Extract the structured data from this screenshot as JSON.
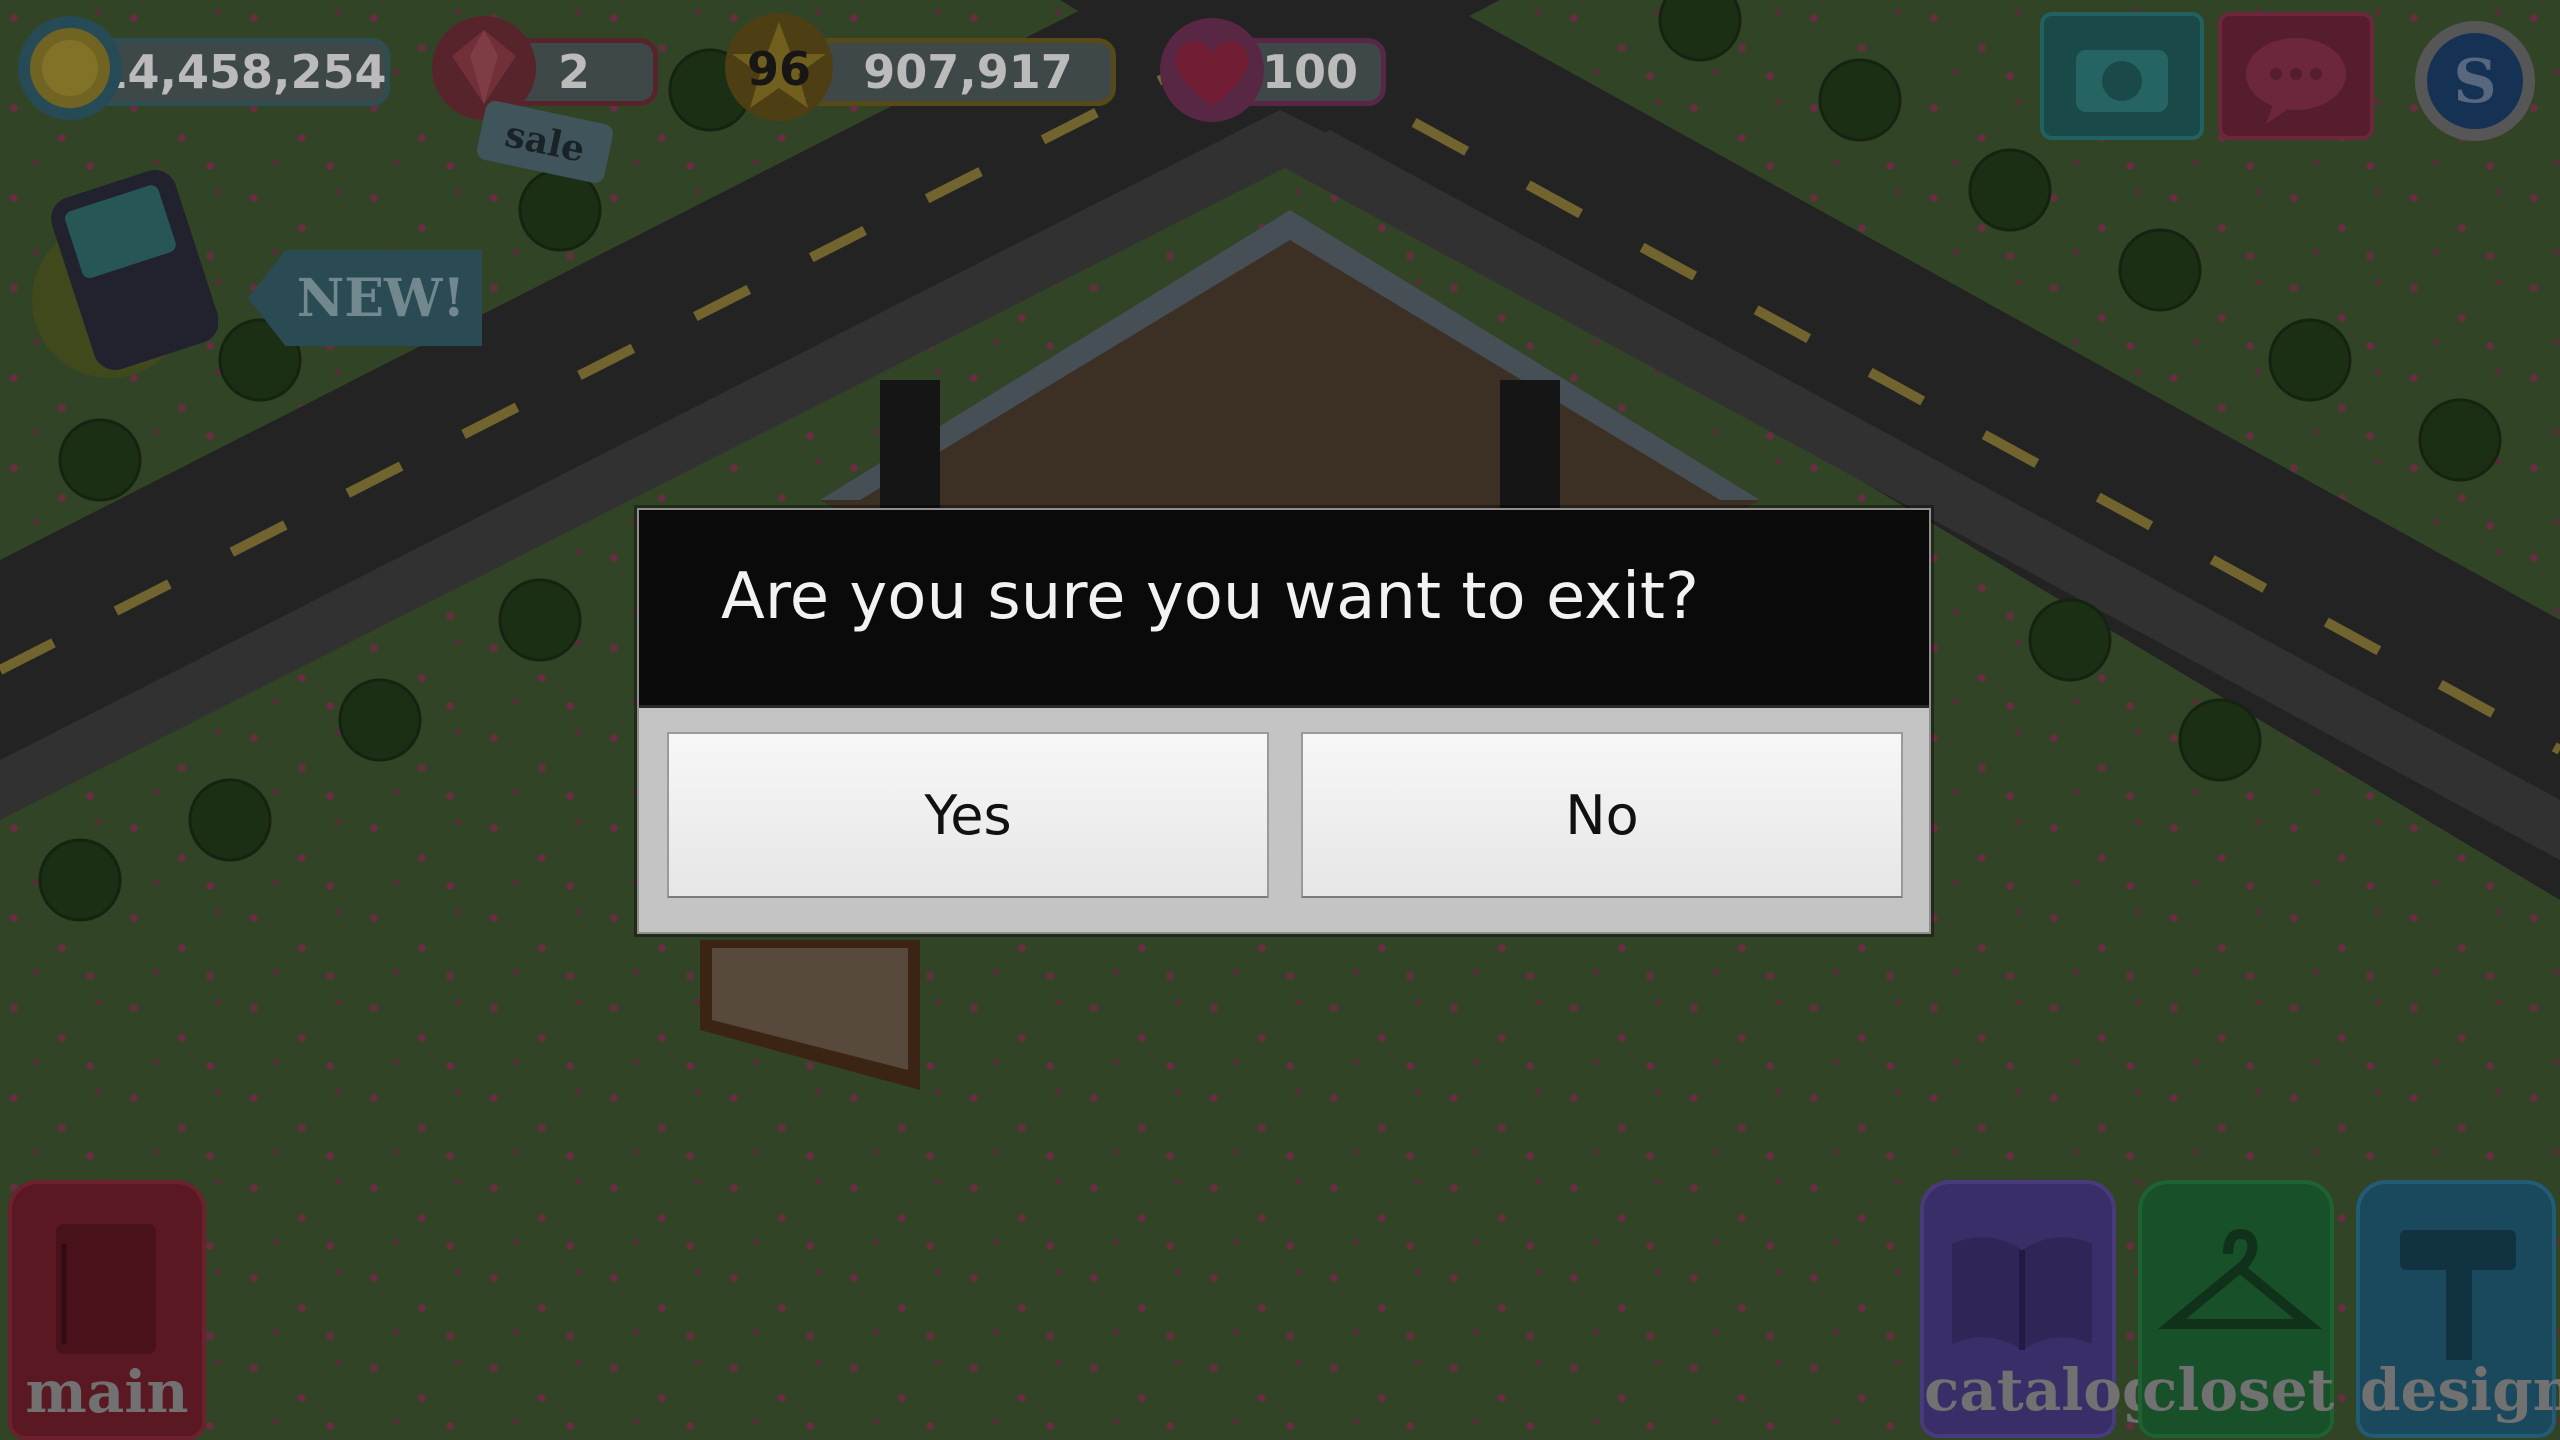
{
  "hud": {
    "coins": "14,458,254",
    "gems": "2",
    "sale_label": "sale",
    "level": "96",
    "experience": "907,917",
    "energy": "100",
    "new_label": "NEW!"
  },
  "nav": {
    "main_label": "main",
    "catalog_label": "catalog",
    "closet_label": "closet",
    "design_label": "design"
  },
  "dialog": {
    "message": "Are you sure you want to exit?",
    "yes_label": "Yes",
    "no_label": "No"
  },
  "icons": {
    "coin": "coin-icon",
    "gem": "gem-icon",
    "star": "star-icon",
    "heart": "heart-icon",
    "camera": "camera-icon",
    "chat": "chat-bubble-icon",
    "social": "social-s-icon",
    "phone": "phone-icon",
    "notebook": "notebook-icon",
    "book": "book-icon",
    "hanger": "hanger-icon",
    "hammer": "hammer-icon"
  },
  "colors": {
    "grass": "#3f5430",
    "road": "#2a2a2a",
    "dialog_header": "#0a0a0a",
    "dialog_body": "#c4c4c4",
    "catalog_tag": "#4b3f8c",
    "closet_tag": "#1f6a36",
    "design_tag": "#23627c",
    "main_tag": "#7a1f2a"
  }
}
